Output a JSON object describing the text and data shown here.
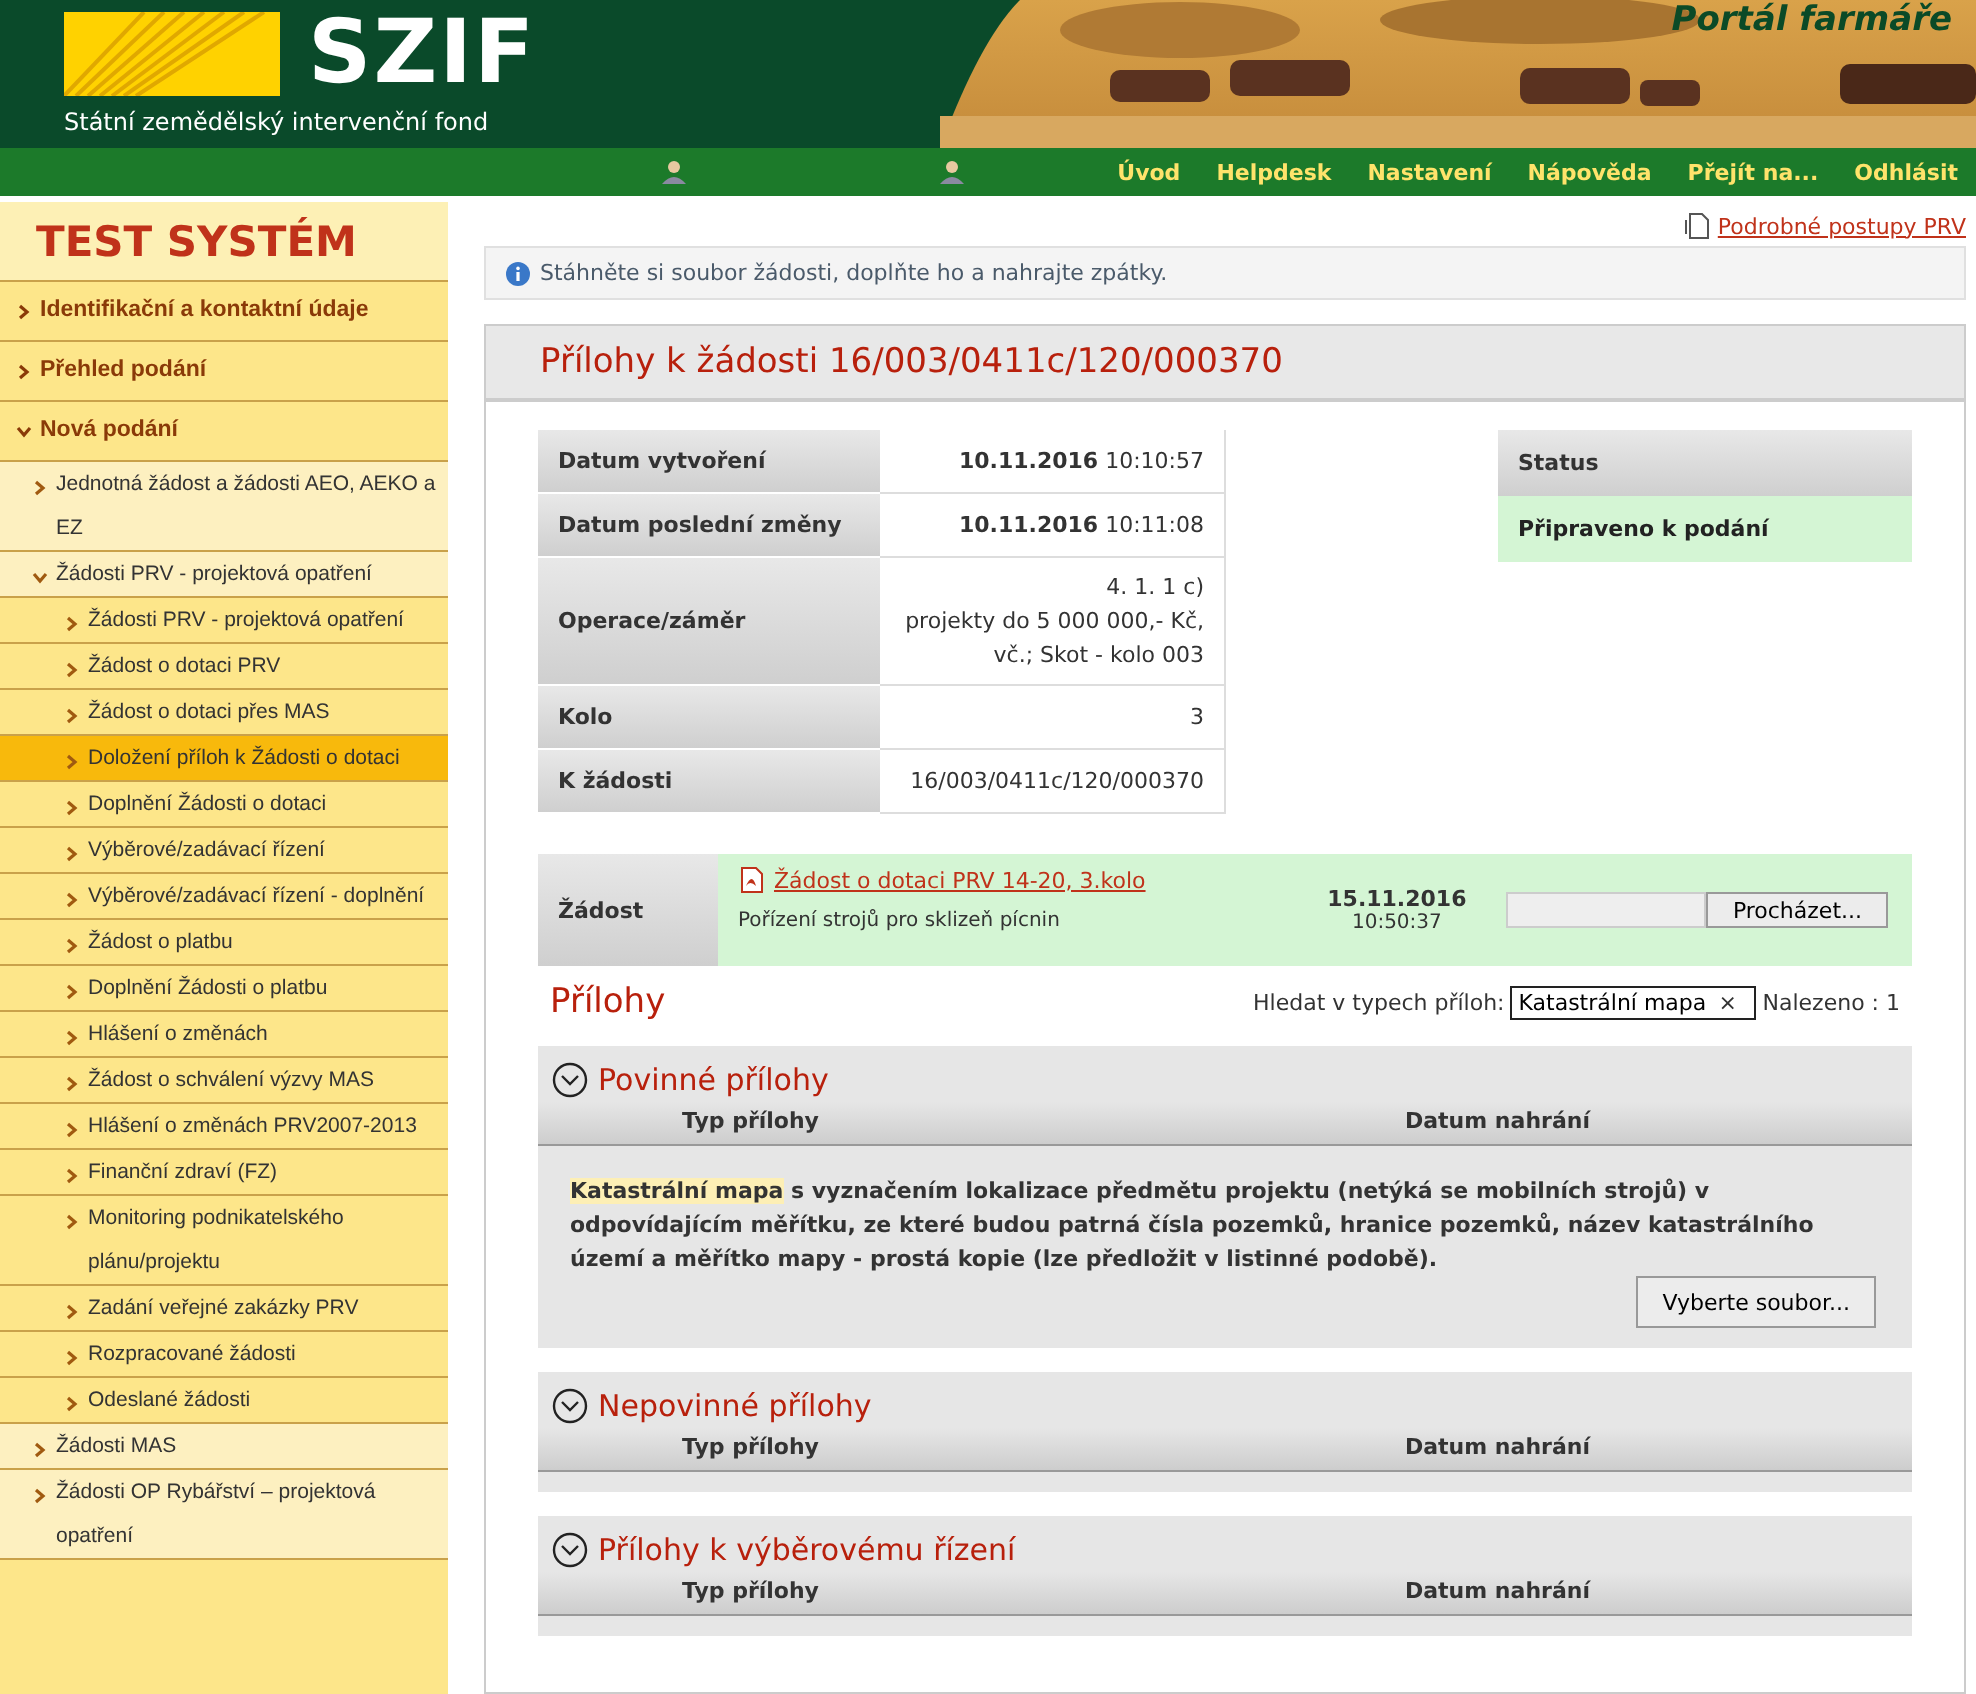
{
  "header": {
    "brand": "SZIF",
    "subtitle": "Státní zemědělský intervenční fond",
    "portal": "Portál farmáře"
  },
  "nav": [
    {
      "label": "Úvod"
    },
    {
      "label": "Helpdesk"
    },
    {
      "label": "Nastavení"
    },
    {
      "label": "Nápověda"
    },
    {
      "label": "Přejít na..."
    },
    {
      "label": "Odhlásit"
    }
  ],
  "sidebar": {
    "title": "TEST SYSTÉM",
    "items": [
      {
        "label": "Identifikační a kontaktní údaje",
        "expanded": false,
        "selected": false
      },
      {
        "label": "Přehled podání",
        "expanded": false,
        "selected": false
      },
      {
        "label": "Nová podání",
        "expanded": true,
        "selected": false,
        "children": [
          {
            "label": "Jednotná žádost a žádosti AEO, AEKO a EZ",
            "expanded": false,
            "selected": false
          },
          {
            "label": "Žádosti PRV - projektová opatření",
            "expanded": true,
            "selected": false,
            "children": [
              {
                "label": "Žádosti PRV - projektová opatření",
                "selected": false
              },
              {
                "label": "Žádost o dotaci PRV",
                "selected": false
              },
              {
                "label": "Žádost o dotaci přes MAS",
                "selected": false
              },
              {
                "label": "Doložení příloh k Žádosti o dotaci",
                "selected": true
              },
              {
                "label": "Doplnění Žádosti o dotaci",
                "selected": false
              },
              {
                "label": "Výběrové/zadávací řízení",
                "selected": false
              },
              {
                "label": "Výběrové/zadávací řízení - doplnění",
                "selected": false
              },
              {
                "label": "Žádost o platbu",
                "selected": false
              },
              {
                "label": "Doplnění Žádosti o platbu",
                "selected": false
              },
              {
                "label": "Hlášení o změnách",
                "selected": false
              },
              {
                "label": "Žádost o schválení výzvy MAS",
                "selected": false
              },
              {
                "label": "Hlášení o změnách PRV2007-2013",
                "selected": false
              },
              {
                "label": "Finanční zdraví (FZ)",
                "selected": false
              },
              {
                "label": "Monitoring podnikatelského plánu/projektu",
                "selected": false
              },
              {
                "label": "Zadání veřejné zakázky PRV",
                "selected": false
              },
              {
                "label": "Rozpracované žádosti",
                "selected": false
              },
              {
                "label": "Odeslané žádosti",
                "selected": false
              }
            ]
          },
          {
            "label": "Žádosti MAS",
            "expanded": false,
            "selected": false
          },
          {
            "label": "Žádosti OP Rybářství – projektová opatření",
            "expanded": false,
            "selected": false
          }
        ]
      }
    ]
  },
  "help_link": "Podrobné postupy PRV",
  "info": "Stáhněte si soubor žádosti, doplňte ho a nahrajte zpátky.",
  "panel_title": "Přílohy k žádosti 16/003/0411c/120/000370",
  "details": [
    {
      "label": "Datum vytvoření",
      "date": "10.11.2016",
      "time": "10:10:57"
    },
    {
      "label": "Datum poslední změny",
      "date": "10.11.2016",
      "time": "10:11:08"
    },
    {
      "label": "Operace/záměr",
      "lines": [
        "4. 1. 1 c)",
        "projekty do 5 000 000,- Kč,",
        "vč.; Skot - kolo 003"
      ]
    },
    {
      "label": "Kolo",
      "lines": [
        "3"
      ]
    },
    {
      "label": "K žádosti",
      "lines": [
        "16/003/0411c/120/000370"
      ]
    }
  ],
  "status": {
    "label": "Status",
    "value": "Připraveno k podání"
  },
  "request": {
    "label": "Žádost",
    "file": "Žádost o dotaci PRV 14-20, 3.kolo",
    "description": "Pořízení strojů pro sklizeň pícnin",
    "date": "15.11.2016",
    "time": "10:50:37",
    "browse": "Procházet..."
  },
  "attachments": {
    "title": "Přílohy",
    "search_label": "Hledat v typech příloh:",
    "search_value": "Katastrální mapa",
    "clear": "×",
    "found": "Nalezeno : 1",
    "sections": [
      {
        "title": "Povinné přílohy",
        "expanded": true,
        "columns": [
          "Typ přílohy",
          "Datum nahrání"
        ],
        "rows": [
          {
            "text": "**Katastrální mapa** s vyznačením lokalizace předmětu projektu (netýká se mobilních strojů) v odpovídajícím měřítku, ze které budou patrná čísla pozemků, hranice pozemků, název katastrálního území a měřítko mapy - prostá kopie (lze předložit v listinné podobě).",
            "button": "Vyberte soubor..."
          }
        ]
      },
      {
        "title": "Nepovinné přílohy",
        "expanded": true,
        "columns": [
          "Typ přílohy",
          "Datum nahrání"
        ]
      },
      {
        "title": "Přílohy k výběrovému řízení",
        "expanded": true,
        "columns": [
          "Typ přílohy",
          "Datum nahrání"
        ]
      }
    ]
  }
}
